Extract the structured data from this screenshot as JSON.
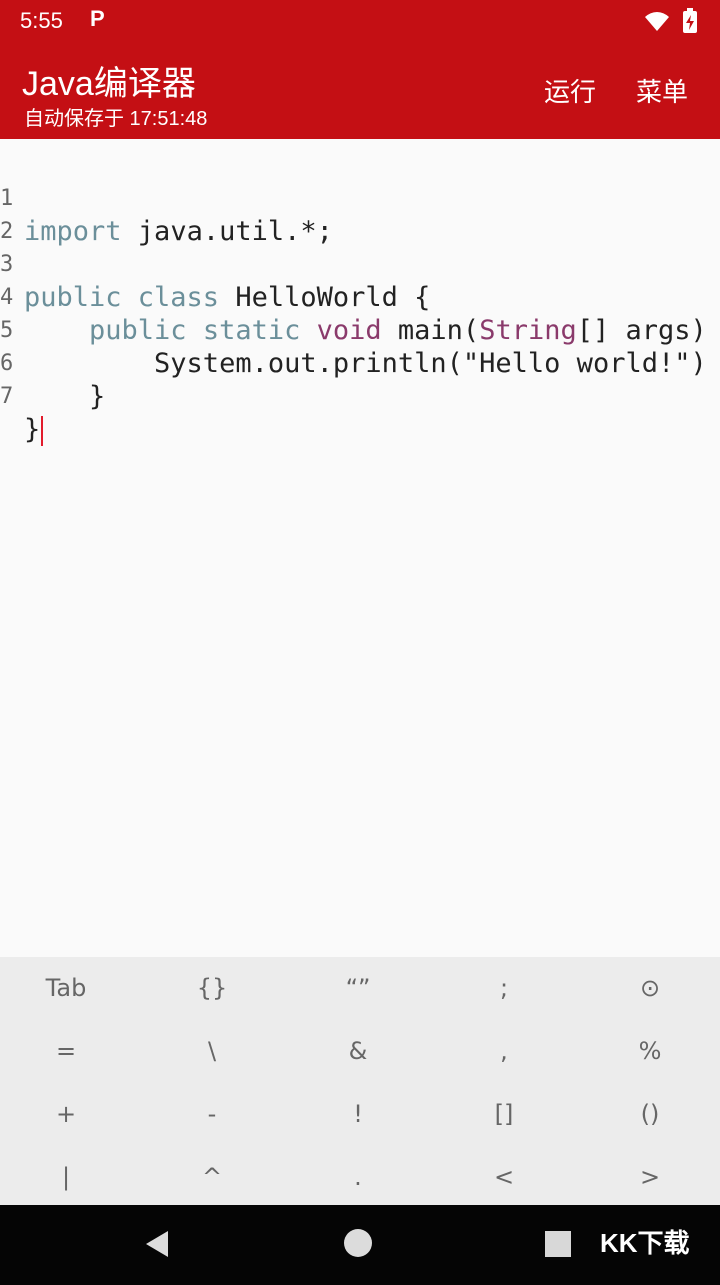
{
  "status_bar": {
    "time": "5:55",
    "notification_icon": "P",
    "icons": [
      "wifi-icon",
      "battery-icon"
    ]
  },
  "toolbar": {
    "title": "Java编译器",
    "subtitle": "自动保存于 17:51:48",
    "run_label": "运行",
    "menu_label": "菜单",
    "color": "#c40f14"
  },
  "editor": {
    "lines": [
      {
        "num": "1",
        "text": "import java.util.*;"
      },
      {
        "num": "2",
        "text": ""
      },
      {
        "num": "3",
        "text": "public class HelloWorld {"
      },
      {
        "num": "4",
        "text": "    public static void main(String[] args)"
      },
      {
        "num": "5",
        "text": "        System.out.println(\"Hello world!\")"
      },
      {
        "num": "6",
        "text": "    }"
      },
      {
        "num": "7",
        "text": "}"
      }
    ]
  },
  "keyboard": {
    "keys": [
      [
        "Tab",
        "{}",
        "“”",
        ";",
        "⊙"
      ],
      [
        "=",
        "\\",
        "&",
        ",",
        "%"
      ],
      [
        "+",
        "-",
        "!",
        "[]",
        "()"
      ],
      [
        "|",
        "^",
        ".",
        "<",
        ">"
      ]
    ]
  },
  "nav_bar": {
    "watermark": "KK下载"
  }
}
